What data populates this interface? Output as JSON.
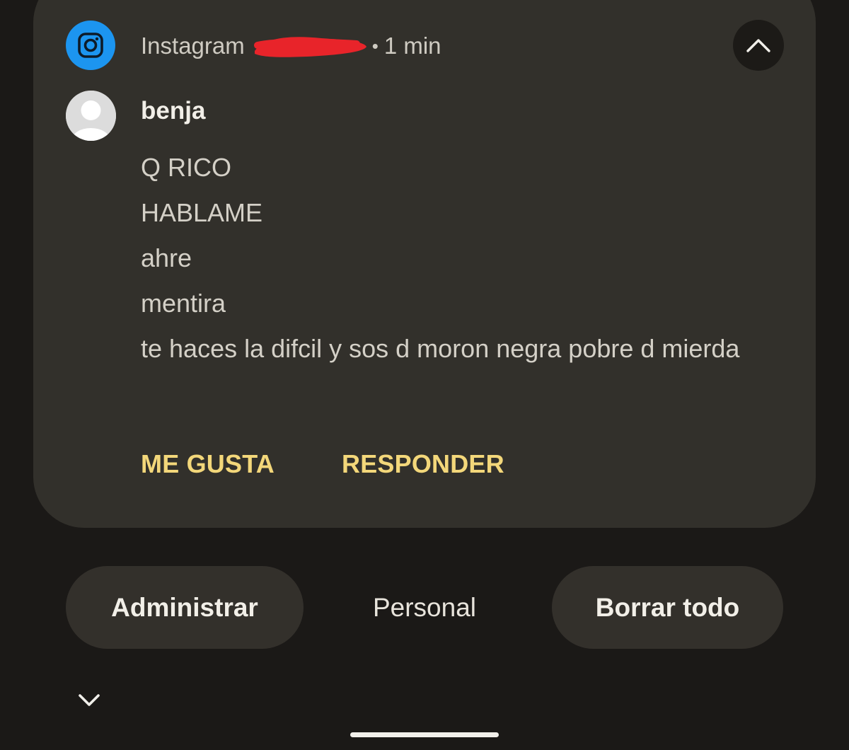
{
  "notification": {
    "app_name": "Instagram",
    "separator": "•",
    "time": "1 min",
    "app_icon": "instagram-icon",
    "collapse_icon": "chevron-up-icon",
    "sender": "benja",
    "messages": [
      "Q RICO",
      "HABLAME",
      "ahre",
      "mentira",
      "te haces la difcil y sos d moron negra pobre d mierda"
    ],
    "actions": {
      "like": "ME GUSTA",
      "reply": "RESPONDER"
    }
  },
  "footer": {
    "manage": "Administrar",
    "profile": "Personal",
    "clear_all": "Borrar todo",
    "expand_icon": "chevron-down-icon"
  },
  "colors": {
    "background": "#1b1917",
    "card": "#32302b",
    "accent": "#f3d77a",
    "instagram_blue": "#1c95f0",
    "redaction": "#e8242a"
  }
}
